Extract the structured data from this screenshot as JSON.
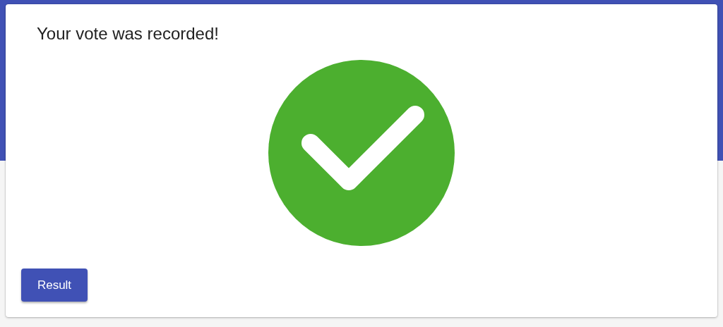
{
  "title": "Your vote was recorded!",
  "status": {
    "kind": "success"
  },
  "buttons": [
    {
      "label": "Result"
    }
  ]
}
